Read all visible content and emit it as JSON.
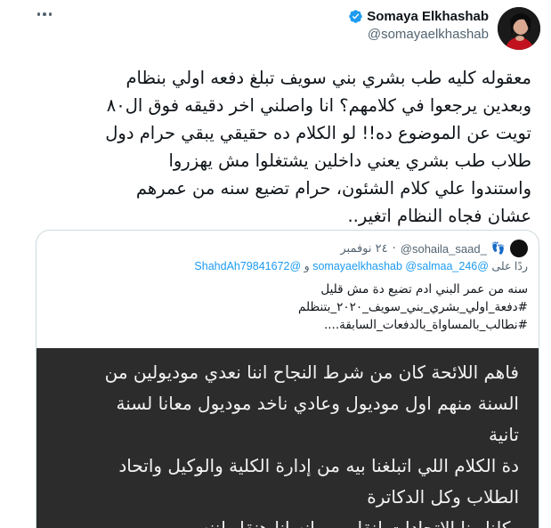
{
  "author": {
    "display_name": "Somaya Elkhashab",
    "handle": "@somayaelkhashab"
  },
  "tweet": {
    "lines": [
      "معقوله كليه طب بشري بني سويف تبلغ دفعه اولي بنظام",
      "وبعدين يرجعوا في كلامهم؟ انا واصلني اخر دقيقه فوق ال٨٠",
      "تويت عن الموضوع ده!! لو الكلام ده حقيقي يبقي حرام دول",
      "طلاب طب بشري يعني داخلين يشتغلوا مش يهزروا",
      "واستندوا علي كلام الشئون، حرام تضيع سنه من عمرهم",
      "عشان فجاه النظام اتغير.."
    ]
  },
  "quote": {
    "handle": "@sohaila_saad_",
    "emoji": "👣",
    "date": "٢٤ نوفمبر",
    "reply_prefix": "ردًا على",
    "reply_mentions": "@somayaelkhashab @salmaa_246",
    "reply_and": "و",
    "reply_extra": "@ShahdAh79841672",
    "body": [
      "سنه من عمر البني ادم تضيع دة مش قليل",
      "#دفعة_اولي_بشري_بني_سويف_٢٠٢٠_بتنظلم",
      "#نطالب_بالمساواة_بالدفعات_السابقة...."
    ],
    "image_text": [
      "فاهم اللائحة كان من شرط النجاح اننا نعدي موديولين من",
      "السنة منهم اول موديول وعادي ناخد موديول معانا لسنة",
      "تانية",
      "دة الكلام اللي اتبلغنا بيه من إدارة الكلية والوكيل واتحاد",
      "الطلاب وكل الدكاترة",
      "وكلنا ونا الاتحادات لنقل من انه انا هنقل لننه"
    ]
  },
  "icons": {
    "more": "more-horizontal-icon",
    "verified": "verified-badge-icon"
  },
  "colors": {
    "accent": "#1d9bf0",
    "text": "#0f1419",
    "muted": "#536471",
    "image_bg": "#2d2c2c"
  }
}
